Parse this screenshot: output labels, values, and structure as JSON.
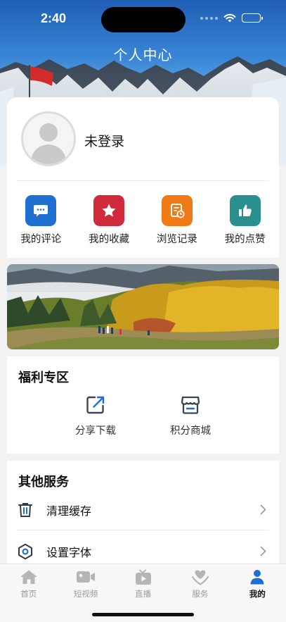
{
  "status_bar": {
    "time": "2:40"
  },
  "header": {
    "title": "个人中心"
  },
  "profile": {
    "login_status": "未登录"
  },
  "quick_actions": [
    {
      "label": "我的评论",
      "icon": "comment-icon",
      "color": "#1f6fd0"
    },
    {
      "label": "我的收藏",
      "icon": "star-icon",
      "color": "#d12a3a"
    },
    {
      "label": "浏览记录",
      "icon": "history-icon",
      "color": "#f07a16"
    },
    {
      "label": "我的点赞",
      "icon": "thumbs-up-icon",
      "color": "#2a8f8f"
    }
  ],
  "welfare": {
    "title": "福利专区",
    "items": [
      {
        "label": "分享下载",
        "icon": "share-icon"
      },
      {
        "label": "积分商城",
        "icon": "store-icon"
      }
    ]
  },
  "services": {
    "title": "其他服务",
    "items": [
      {
        "label": "清理缓存",
        "icon": "trash-icon"
      },
      {
        "label": "设置字体",
        "icon": "font-settings-icon"
      }
    ]
  },
  "tab_bar": {
    "tabs": [
      {
        "label": "首页",
        "icon": "home-icon",
        "active": false
      },
      {
        "label": "短视频",
        "icon": "video-camera-icon",
        "active": false
      },
      {
        "label": "直播",
        "icon": "live-tv-icon",
        "active": false
      },
      {
        "label": "服务",
        "icon": "service-heart-icon",
        "active": false
      },
      {
        "label": "我的",
        "icon": "user-icon",
        "active": true
      }
    ],
    "active_color": "#1f6fd0",
    "inactive_color": "#b5b5b5"
  }
}
